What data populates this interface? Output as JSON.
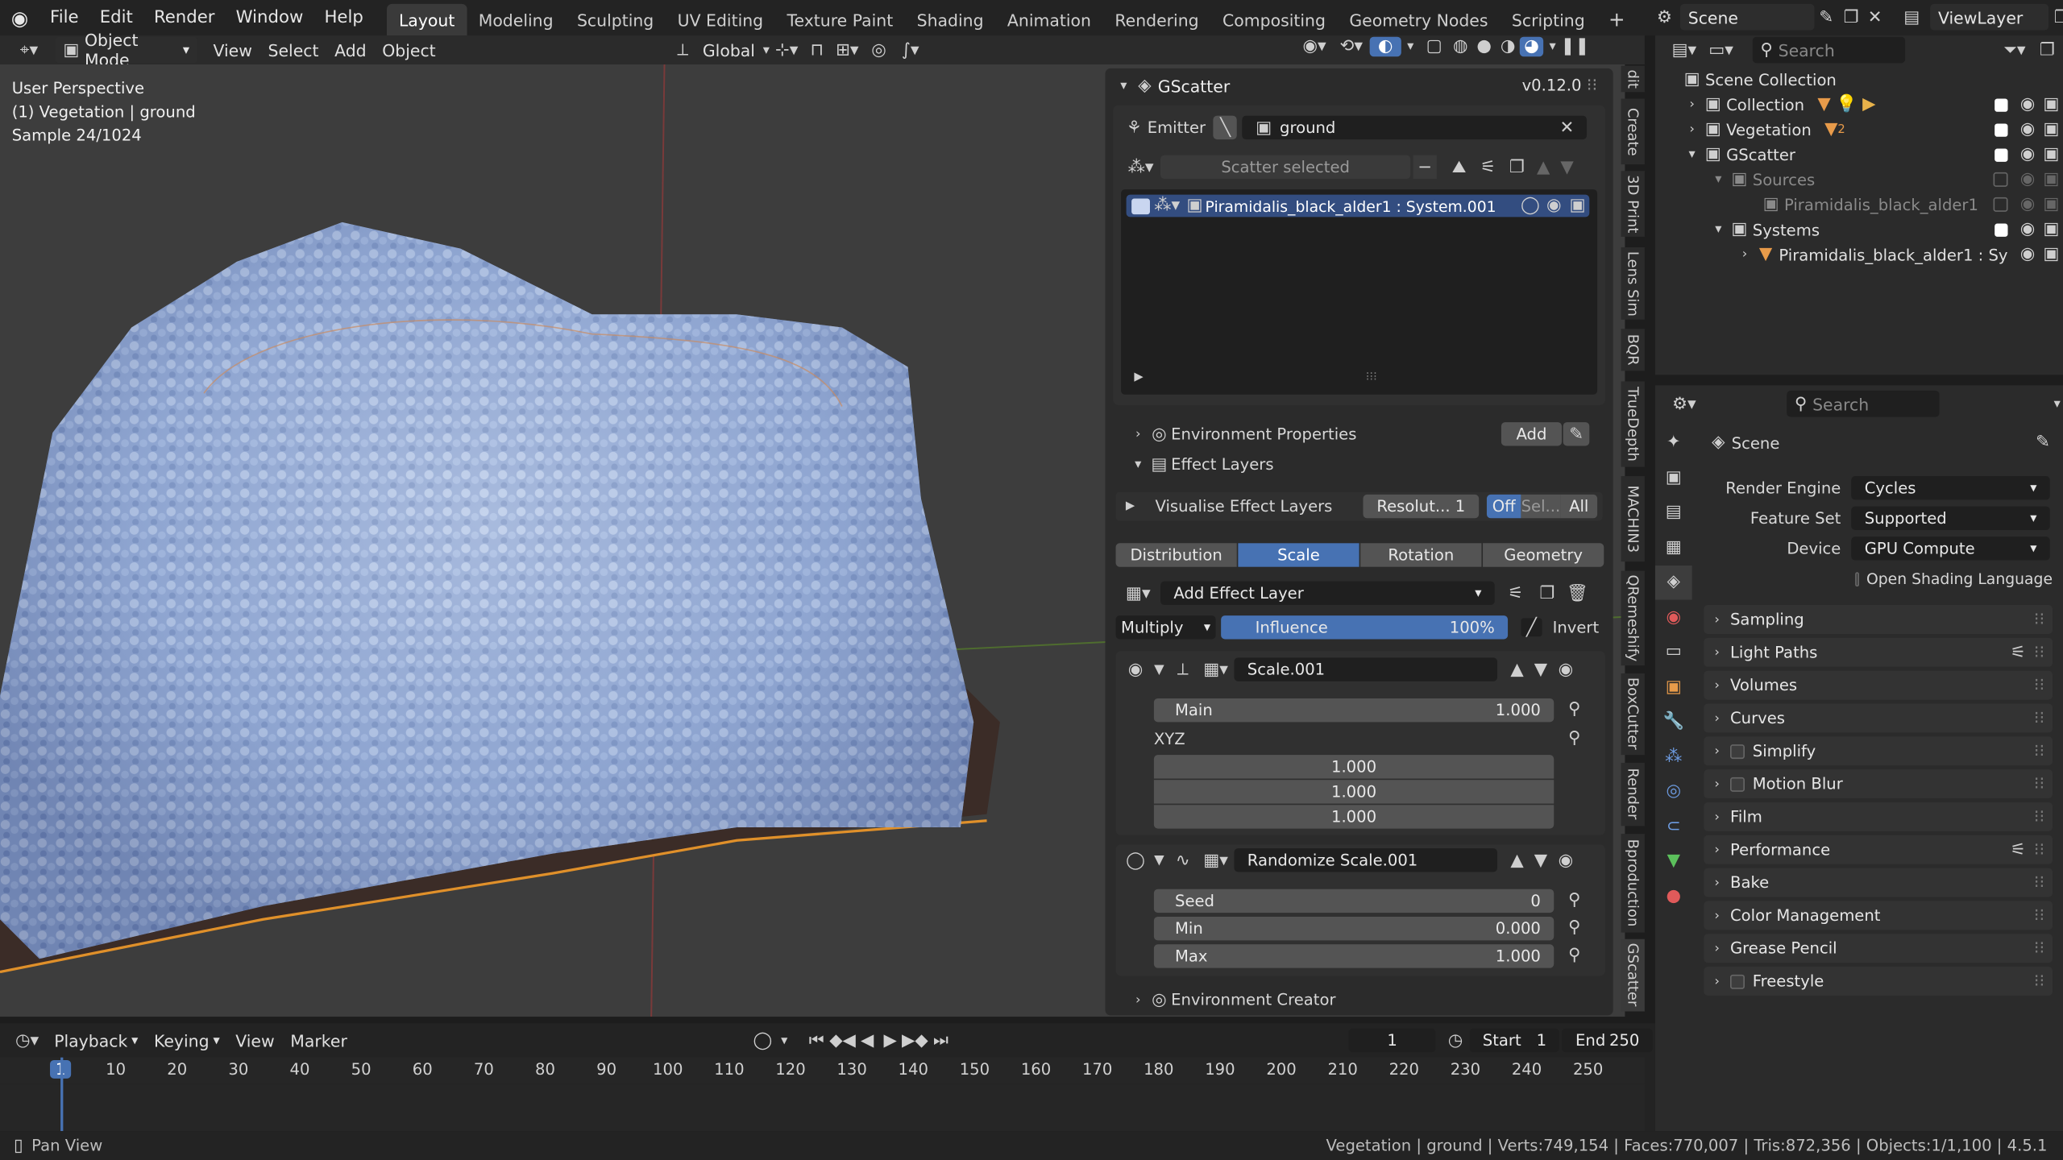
{
  "menus": [
    "File",
    "Edit",
    "Render",
    "Window",
    "Help"
  ],
  "workspaces": [
    "Layout",
    "Modeling",
    "Sculpting",
    "UV Editing",
    "Texture Paint",
    "Shading",
    "Animation",
    "Rendering",
    "Compositing",
    "Geometry Nodes",
    "Scripting"
  ],
  "scene": "Scene",
  "view_layer": "ViewLayer",
  "viewport": {
    "mode": "Object Mode",
    "menus": [
      "View",
      "Select",
      "Add",
      "Object"
    ],
    "orientation": "Global",
    "info": [
      "User Perspective",
      "(1) Vegetation | ground",
      "Sample 24/1024"
    ]
  },
  "gscatter": {
    "title": "GScatter",
    "version": "v0.12.0",
    "emitter_label": "Emitter",
    "emitter": "ground",
    "scatter_selected": "Scatter selected",
    "system_item": "Piramidalis_black_alder1 : System.001",
    "env_props": "Environment Properties",
    "add": "Add",
    "effect_layers": "Effect Layers",
    "visualise": "Visualise Effect Layers",
    "resolution": "Resolut... 1",
    "vis_modes": [
      "Off",
      "Sel...",
      "All"
    ],
    "tabs": [
      "Distribution",
      "Scale",
      "Rotation",
      "Geometry"
    ],
    "add_effect": "Add Effect Layer",
    "blend": "Multiply",
    "influence_label": "Influence",
    "influence_value": "100%",
    "invert": "Invert",
    "layer1": {
      "name": "Scale.001",
      "main_label": "Main",
      "main_value": "1.000",
      "xyz_label": "XYZ",
      "xyz": [
        "1.000",
        "1.000",
        "1.000"
      ]
    },
    "layer2": {
      "name": "Randomize Scale.001",
      "seed_label": "Seed",
      "seed": "0",
      "min_label": "Min",
      "min": "0.000",
      "max_label": "Max",
      "max": "1.000"
    },
    "env_creator": "Environment Creator"
  },
  "vtabs": [
    "dit",
    "Create",
    "3D Print",
    "Lens Sim",
    "BQR",
    "TrueDepth",
    "MACHIN3",
    "QRemeshify",
    "BoxCutter",
    "Render",
    "Bproduction",
    "GScatter"
  ],
  "outliner": {
    "search_placeholder": "Search",
    "rows": [
      {
        "label": "Scene Collection"
      },
      {
        "label": "Collection"
      },
      {
        "label": "Vegetation",
        "badge": "2"
      },
      {
        "label": "GScatter"
      },
      {
        "label": "Sources"
      },
      {
        "label": "Piramidalis_black_alder1"
      },
      {
        "label": "Systems"
      },
      {
        "label": "Piramidalis_black_alder1 : Sy"
      }
    ]
  },
  "properties": {
    "search_placeholder": "Search",
    "scene": "Scene",
    "render_engine_label": "Render Engine",
    "render_engine": "Cycles",
    "feature_set_label": "Feature Set",
    "feature_set": "Supported",
    "device_label": "Device",
    "device": "GPU Compute",
    "osl": "Open Shading Language",
    "sections": [
      "Sampling",
      "Light Paths",
      "Volumes",
      "Curves",
      "Simplify",
      "Motion Blur",
      "Film",
      "Performance",
      "Bake",
      "Color Management",
      "Grease Pencil",
      "Freestyle"
    ]
  },
  "timeline": {
    "menus": [
      "Playback",
      "Keying",
      "View",
      "Marker"
    ],
    "current_frame": "1",
    "start_label": "Start",
    "start": "1",
    "end_label": "End",
    "end": "250",
    "ticks": [
      "1",
      "10",
      "20",
      "30",
      "40",
      "50",
      "60",
      "70",
      "80",
      "90",
      "100",
      "110",
      "120",
      "130",
      "140",
      "150",
      "160",
      "170",
      "180",
      "190",
      "200",
      "210",
      "220",
      "230",
      "240",
      "250"
    ]
  },
  "status": {
    "left": "Pan View",
    "right": "Vegetation | ground | Verts:749,154 | Faces:770,007 | Tris:872,356 | Objects:1/1,100 | 4.5.1"
  }
}
